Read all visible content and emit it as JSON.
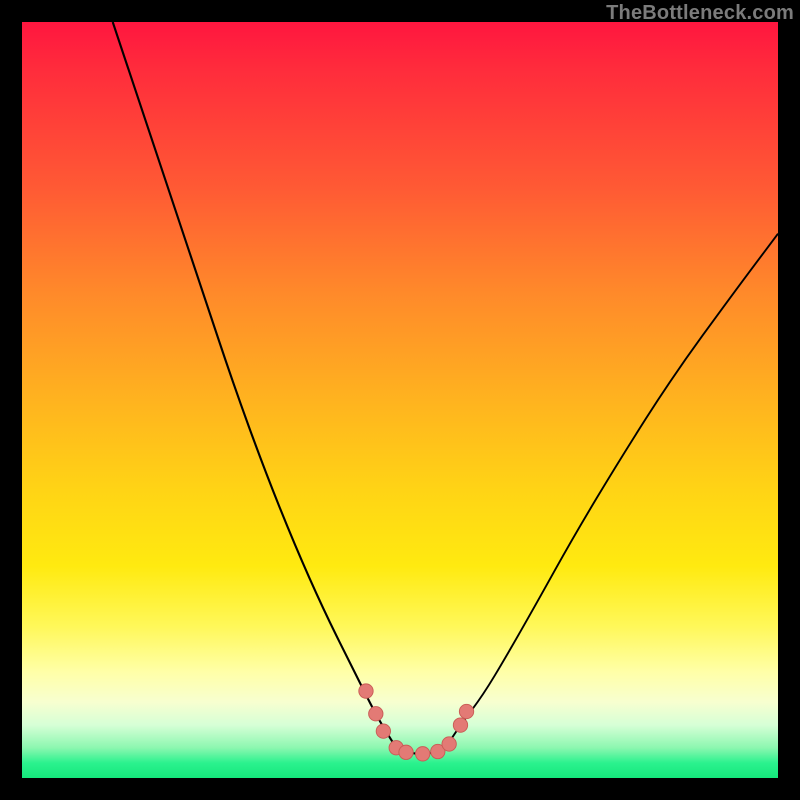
{
  "watermark": "TheBottleneck.com",
  "colors": {
    "frame_bg": "#000000",
    "curve_stroke": "#000000",
    "marker_fill": "#e37a75",
    "marker_stroke": "#c95b55"
  },
  "chart_data": {
    "type": "line",
    "title": "",
    "xlabel": "",
    "ylabel": "",
    "xlim": [
      0,
      100
    ],
    "ylim": [
      0,
      100
    ],
    "grid": false,
    "legend": false,
    "note": "No numeric axis labels are visible; values below are estimated from pixel positions on a 0–100 normalized scale (0,0 = top-left of gradient area).",
    "series": [
      {
        "name": "left-curve",
        "x": [
          12,
          16,
          20,
          24,
          28,
          32,
          36,
          40,
          44,
          47,
          49.5
        ],
        "y": [
          0,
          12,
          24,
          36,
          48,
          59,
          69,
          78,
          86,
          92,
          96
        ]
      },
      {
        "name": "right-curve",
        "x": [
          56,
          58,
          61,
          64,
          68,
          73,
          79,
          86,
          94,
          100
        ],
        "y": [
          96,
          93,
          89,
          84,
          77,
          68,
          58,
          47,
          36,
          28
        ]
      },
      {
        "name": "flat-bottom",
        "x": [
          49.5,
          51,
          53,
          55,
          56
        ],
        "y": [
          96,
          96.7,
          96.8,
          96.6,
          96
        ]
      }
    ],
    "markers": {
      "name": "highlight-points",
      "points": [
        {
          "x": 45.5,
          "y": 88.5
        },
        {
          "x": 46.8,
          "y": 91.5
        },
        {
          "x": 47.8,
          "y": 93.8
        },
        {
          "x": 49.5,
          "y": 96.0
        },
        {
          "x": 50.8,
          "y": 96.6
        },
        {
          "x": 53.0,
          "y": 96.8
        },
        {
          "x": 55.0,
          "y": 96.5
        },
        {
          "x": 56.5,
          "y": 95.5
        },
        {
          "x": 58.0,
          "y": 93.0
        },
        {
          "x": 58.8,
          "y": 91.2
        }
      ]
    }
  }
}
